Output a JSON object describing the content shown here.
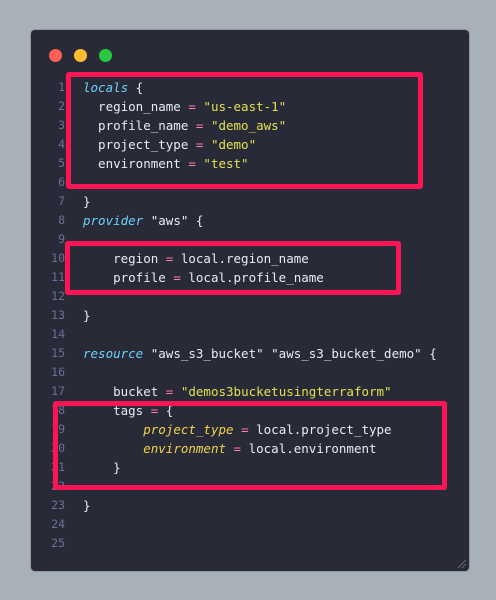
{
  "window": {
    "controls": {
      "close": "close-dot",
      "minimize": "minimize-dot",
      "maximize": "maximize-dot"
    }
  },
  "editor": {
    "lines": [
      {
        "n": "1",
        "parts": [
          {
            "t": "locals",
            "c": "kw"
          },
          {
            "t": " {",
            "c": "plain"
          }
        ]
      },
      {
        "n": "2",
        "parts": [
          {
            "t": "  region_name ",
            "c": "plain"
          },
          {
            "t": "=",
            "c": "op"
          },
          {
            "t": " ",
            "c": "plain"
          },
          {
            "t": "\"us-east-1\"",
            "c": "str"
          }
        ]
      },
      {
        "n": "3",
        "parts": [
          {
            "t": "  profile_name ",
            "c": "plain"
          },
          {
            "t": "=",
            "c": "op"
          },
          {
            "t": " ",
            "c": "plain"
          },
          {
            "t": "\"demo_aws\"",
            "c": "str"
          }
        ]
      },
      {
        "n": "4",
        "parts": [
          {
            "t": "  project_type ",
            "c": "plain"
          },
          {
            "t": "=",
            "c": "op"
          },
          {
            "t": " ",
            "c": "plain"
          },
          {
            "t": "\"demo\"",
            "c": "str"
          }
        ]
      },
      {
        "n": "5",
        "parts": [
          {
            "t": "  environment ",
            "c": "plain"
          },
          {
            "t": "=",
            "c": "op"
          },
          {
            "t": " ",
            "c": "plain"
          },
          {
            "t": "\"test\"",
            "c": "str"
          }
        ]
      },
      {
        "n": "6",
        "parts": []
      },
      {
        "n": "7",
        "parts": [
          {
            "t": "}",
            "c": "plain"
          }
        ]
      },
      {
        "n": "8",
        "parts": [
          {
            "t": "provider",
            "c": "kw"
          },
          {
            "t": " \"aws\" {",
            "c": "plain"
          }
        ]
      },
      {
        "n": "9",
        "parts": []
      },
      {
        "n": "10",
        "parts": [
          {
            "t": "    region ",
            "c": "plain"
          },
          {
            "t": "=",
            "c": "op"
          },
          {
            "t": " local.region_name",
            "c": "plain"
          }
        ]
      },
      {
        "n": "11",
        "parts": [
          {
            "t": "    profile ",
            "c": "plain"
          },
          {
            "t": "=",
            "c": "op"
          },
          {
            "t": " local.profile_name",
            "c": "plain"
          }
        ]
      },
      {
        "n": "12",
        "parts": []
      },
      {
        "n": "13",
        "parts": [
          {
            "t": "}",
            "c": "plain"
          }
        ]
      },
      {
        "n": "14",
        "parts": []
      },
      {
        "n": "15",
        "parts": [
          {
            "t": "resource",
            "c": "kw"
          },
          {
            "t": " \"aws_s3_bucket\" \"aws_s3_bucket_demo\" {",
            "c": "plain"
          }
        ]
      },
      {
        "n": "16",
        "parts": []
      },
      {
        "n": "17",
        "parts": [
          {
            "t": "    bucket ",
            "c": "plain"
          },
          {
            "t": "=",
            "c": "op"
          },
          {
            "t": " ",
            "c": "plain"
          },
          {
            "t": "\"demos3bucketusingterraform\"",
            "c": "str"
          }
        ]
      },
      {
        "n": "18",
        "parts": [
          {
            "t": "    tags ",
            "c": "plain"
          },
          {
            "t": "=",
            "c": "op"
          },
          {
            "t": " {",
            "c": "plain"
          }
        ]
      },
      {
        "n": "19",
        "parts": [
          {
            "t": "        ",
            "c": "plain"
          },
          {
            "t": "project_type",
            "c": "attr"
          },
          {
            "t": " ",
            "c": "plain"
          },
          {
            "t": "=",
            "c": "op"
          },
          {
            "t": " local.project_type",
            "c": "plain"
          }
        ]
      },
      {
        "n": "20",
        "parts": [
          {
            "t": "        ",
            "c": "plain"
          },
          {
            "t": "environment",
            "c": "attr"
          },
          {
            "t": " ",
            "c": "plain"
          },
          {
            "t": "=",
            "c": "op"
          },
          {
            "t": " local.environment",
            "c": "plain"
          }
        ]
      },
      {
        "n": "21",
        "parts": [
          {
            "t": "    }",
            "c": "plain"
          }
        ]
      },
      {
        "n": "22",
        "parts": []
      },
      {
        "n": "23",
        "parts": [
          {
            "t": "}",
            "c": "plain"
          }
        ]
      },
      {
        "n": "24",
        "parts": []
      },
      {
        "n": "25",
        "parts": []
      }
    ]
  },
  "annotations": {
    "color": "#ff1456"
  }
}
